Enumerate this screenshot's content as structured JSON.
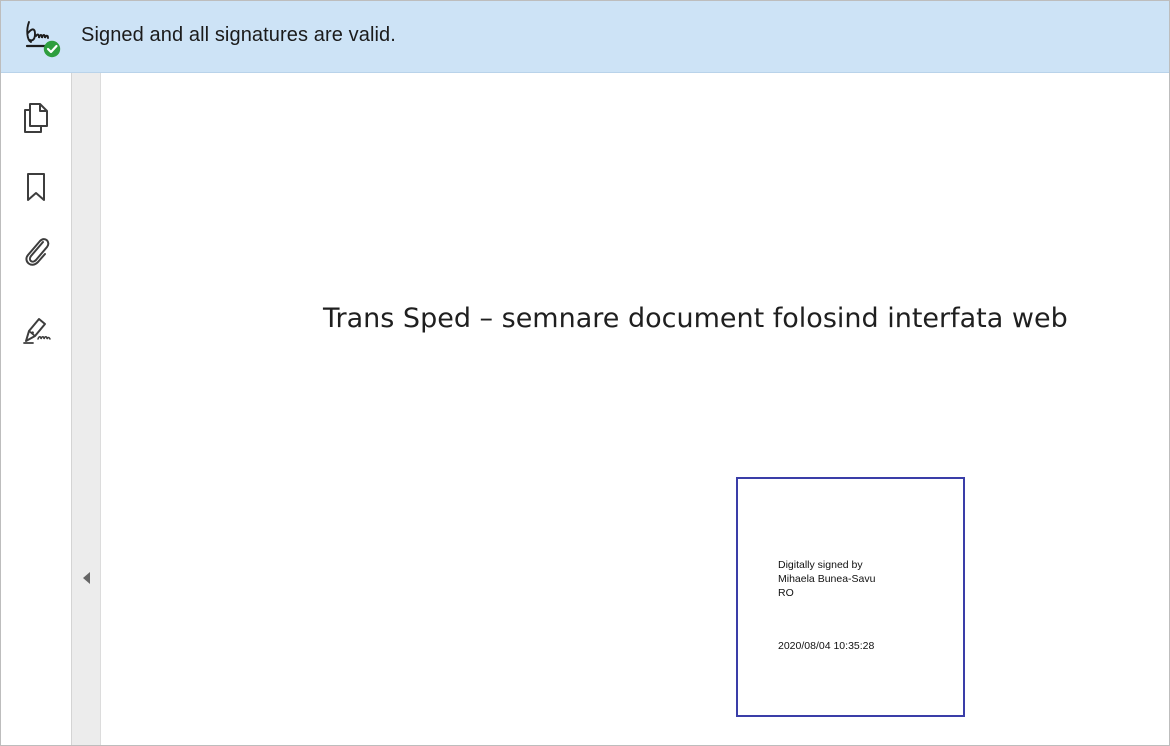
{
  "signature_bar": {
    "icon": "signature-valid-icon",
    "status_text": "Signed and all signatures are valid.",
    "status_color": "#2e9e3e"
  },
  "left_rail": {
    "tools": [
      {
        "icon": "page-thumbnails-icon"
      },
      {
        "icon": "bookmark-icon"
      },
      {
        "icon": "attachment-paperclip-icon"
      },
      {
        "icon": "signature-panel-icon"
      }
    ],
    "collapse_icon": "chevron-left-icon"
  },
  "document": {
    "title": "Trans Sped – semnare document folosind interfata web",
    "signature": {
      "line1": "Digitally signed by",
      "line2": "Mihaela Bunea-Savu",
      "line3": "RO",
      "timestamp": "2020/08/04 10:35:28",
      "border_color": "#3a3ea8"
    }
  }
}
